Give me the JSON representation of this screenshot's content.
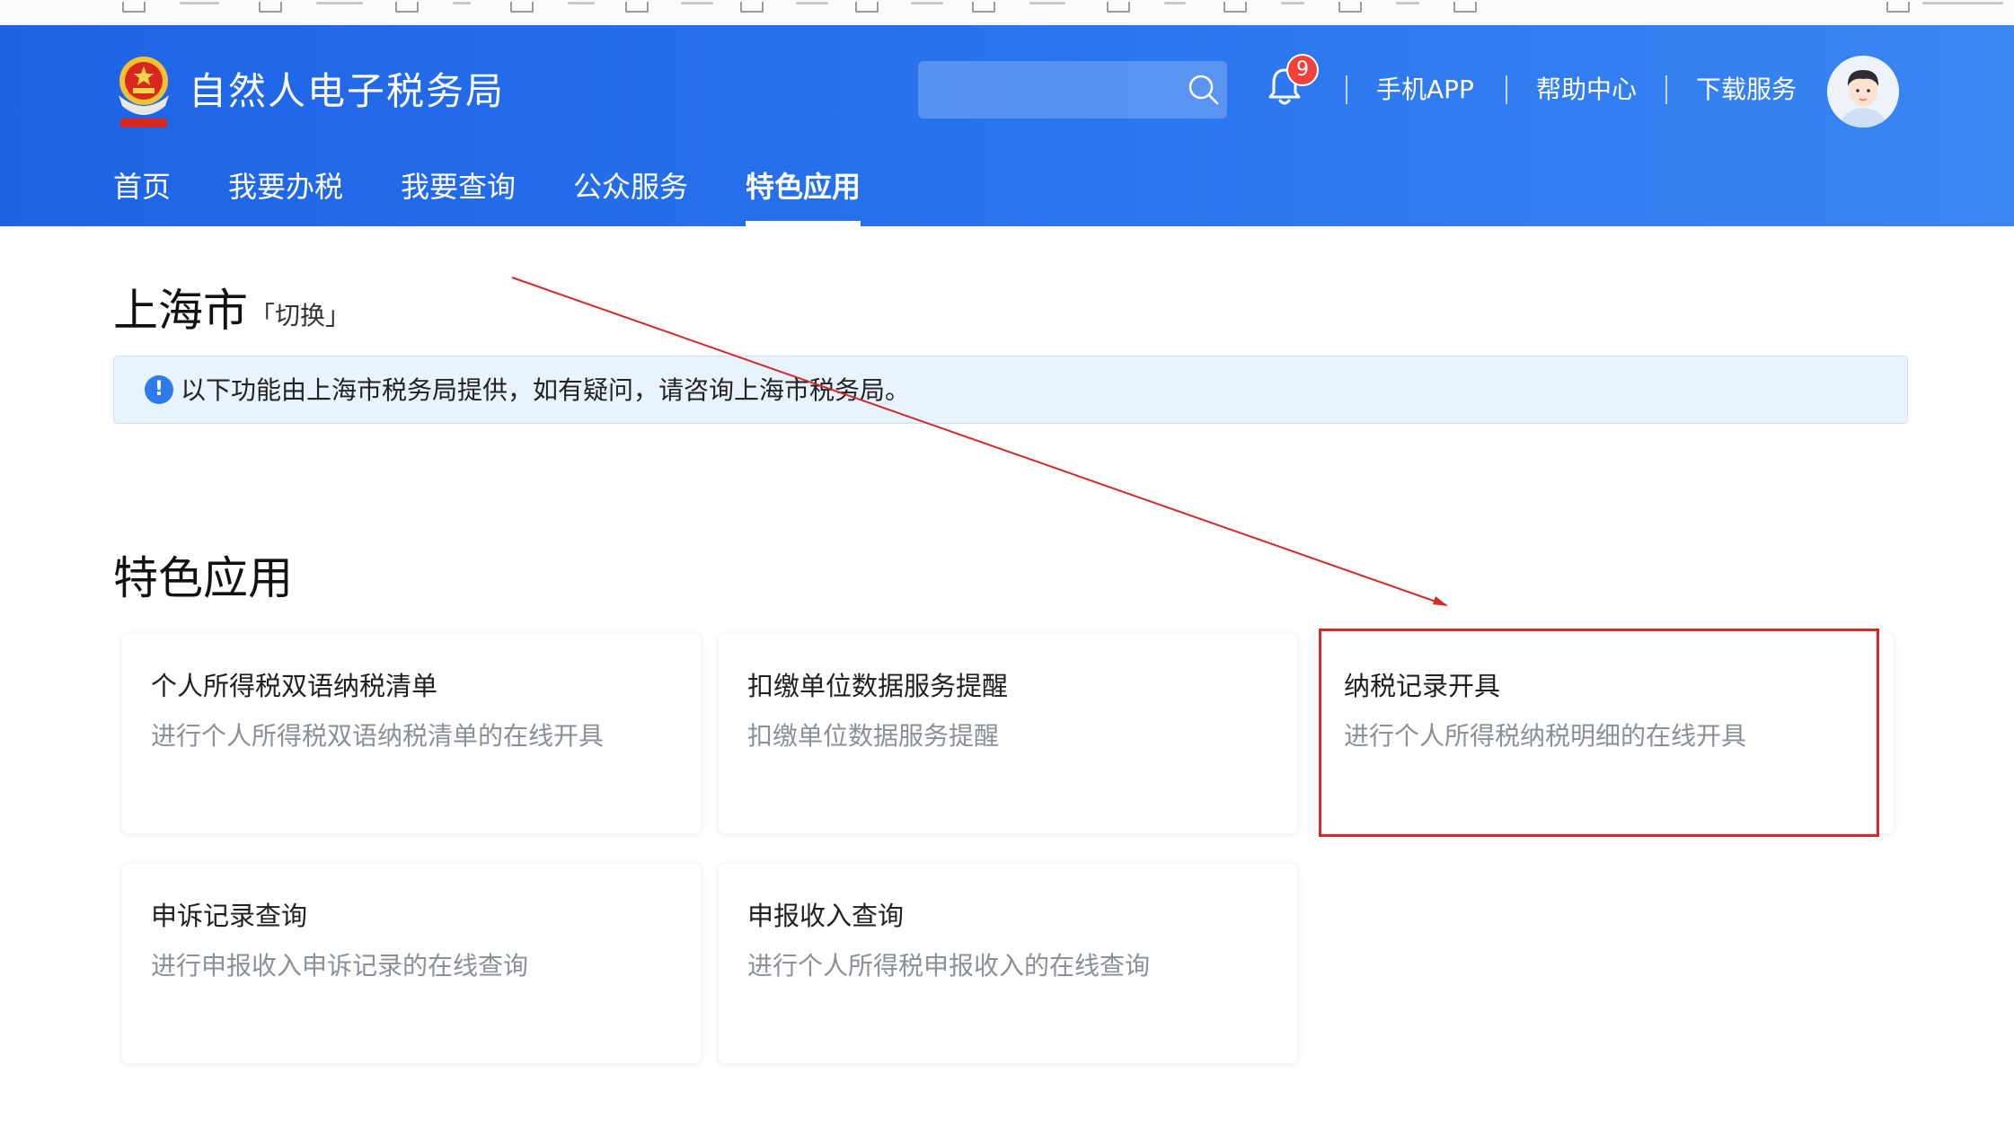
{
  "header": {
    "site_title": "自然人电子税务局",
    "search_placeholder": "",
    "notification_count": "9",
    "links": [
      "手机APP",
      "帮助中心",
      "下载服务"
    ]
  },
  "nav": {
    "items": [
      {
        "label": "首页"
      },
      {
        "label": "我要办税"
      },
      {
        "label": "我要查询"
      },
      {
        "label": "公众服务"
      },
      {
        "label": "特色应用",
        "active": true
      }
    ]
  },
  "region": {
    "name": "上海市",
    "switch_label": "「切换」"
  },
  "notice": {
    "text": "以下功能由上海市税务局提供，如有疑问，请咨询上海市税务局。"
  },
  "section": {
    "title": "特色应用"
  },
  "cards": [
    {
      "title": "个人所得税双语纳税清单",
      "desc": "进行个人所得税双语纳税清单的在线开具"
    },
    {
      "title": "扣缴单位数据服务提醒",
      "desc": "扣缴单位数据服务提醒"
    },
    {
      "title": "纳税记录开具",
      "desc": "进行个人所得税纳税明细的在线开具",
      "highlighted": true
    },
    {
      "title": "申诉记录查询",
      "desc": "进行申报收入申诉记录的在线查询"
    },
    {
      "title": "申报收入查询",
      "desc": "进行个人所得税申报收入的在线查询"
    }
  ],
  "colors": {
    "header_blue": "#1e63e6",
    "annotation_red": "#d42a2a",
    "notice_bg": "#e9f3fe",
    "info_blue": "#2e7bf0"
  }
}
